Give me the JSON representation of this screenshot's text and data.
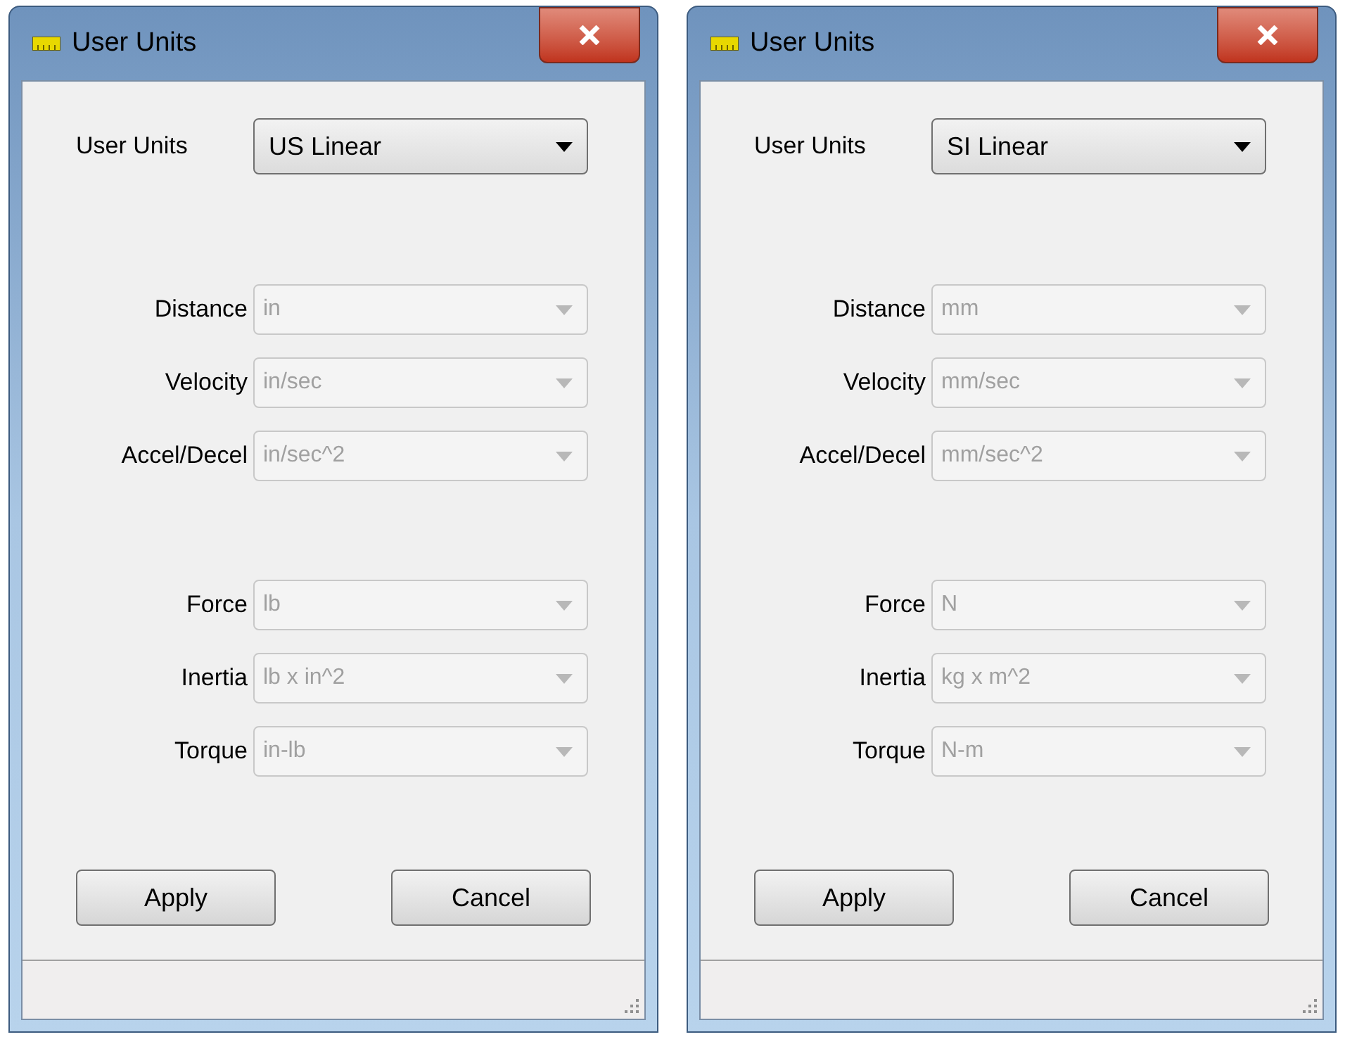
{
  "windows": [
    {
      "title": "User Units",
      "units_selector": {
        "label": "User Units",
        "value": "US Linear"
      },
      "groups": [
        [
          {
            "label": "Distance",
            "value": "in",
            "disabled": true
          },
          {
            "label": "Velocity",
            "value": "in/sec",
            "disabled": true
          },
          {
            "label": "Accel/Decel",
            "value": "in/sec^2",
            "disabled": true
          }
        ],
        [
          {
            "label": "Force",
            "value": "lb",
            "disabled": true
          },
          {
            "label": "Inertia",
            "value": "lb x in^2",
            "disabled": true
          },
          {
            "label": "Torque",
            "value": "in-lb",
            "disabled": true
          }
        ]
      ],
      "buttons": [
        "Apply",
        "Cancel"
      ]
    },
    {
      "title": "User Units",
      "units_selector": {
        "label": "User Units",
        "value": "SI Linear"
      },
      "groups": [
        [
          {
            "label": "Distance",
            "value": "mm",
            "disabled": true
          },
          {
            "label": "Velocity",
            "value": "mm/sec",
            "disabled": true
          },
          {
            "label": "Accel/Decel",
            "value": "mm/sec^2",
            "disabled": true
          }
        ],
        [
          {
            "label": "Force",
            "value": "N",
            "disabled": true
          },
          {
            "label": "Inertia",
            "value": "kg x m^2",
            "disabled": true
          },
          {
            "label": "Torque",
            "value": "N-m",
            "disabled": true
          }
        ]
      ],
      "buttons": [
        "Apply",
        "Cancel"
      ]
    }
  ]
}
